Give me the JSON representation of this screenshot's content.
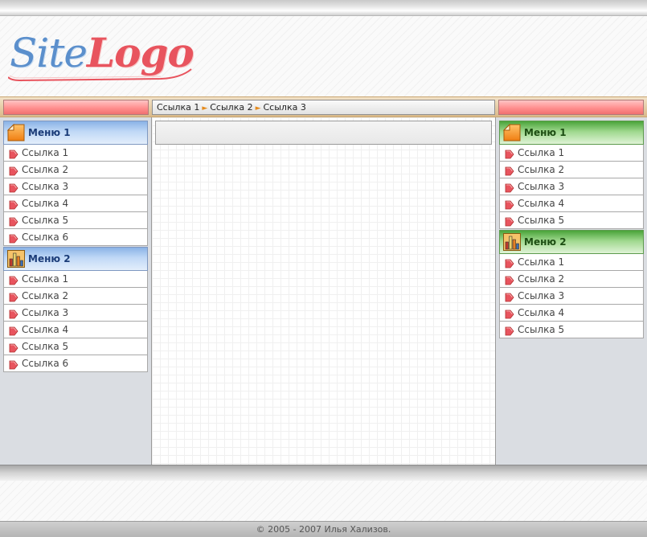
{
  "logo": {
    "part1": "Site",
    "part2": "Logo"
  },
  "breadcrumb": [
    {
      "label": "Ссылка 1"
    },
    {
      "label": "Ссылка 2"
    },
    {
      "label": "Ссылка 3"
    }
  ],
  "left_sidebar": {
    "menus": [
      {
        "title": "Меню 1",
        "icon": "page-icon",
        "items": [
          "Ссылка 1",
          "Ссылка 2",
          "Ссылка 3",
          "Ссылка 4",
          "Ссылка 5",
          "Ссылка 6"
        ]
      },
      {
        "title": "Меню 2",
        "icon": "bar-chart-icon",
        "items": [
          "Ссылка 1",
          "Ссылка 2",
          "Ссылка 3",
          "Ссылка 4",
          "Ссылка 5",
          "Ссылка 6"
        ]
      }
    ]
  },
  "right_sidebar": {
    "menus": [
      {
        "title": "Меню 1",
        "icon": "page-icon",
        "items": [
          "Ссылка 1",
          "Ссылка 2",
          "Ссылка 3",
          "Ссылка 4",
          "Ссылка 5"
        ]
      },
      {
        "title": "Меню 2",
        "icon": "bar-chart-icon",
        "items": [
          "Ссылка 1",
          "Ссылка 2",
          "Ссылка 3",
          "Ссылка 4",
          "Ссылка 5"
        ]
      }
    ]
  },
  "footer": {
    "copyright": "© 2005 - 2007 Илья Хализов."
  },
  "colors": {
    "left_menu_header": "#8ab3e6",
    "right_menu_header": "#4aa43a",
    "red_bar": "#ff8f8f",
    "item_arrow": "#e8545e"
  }
}
